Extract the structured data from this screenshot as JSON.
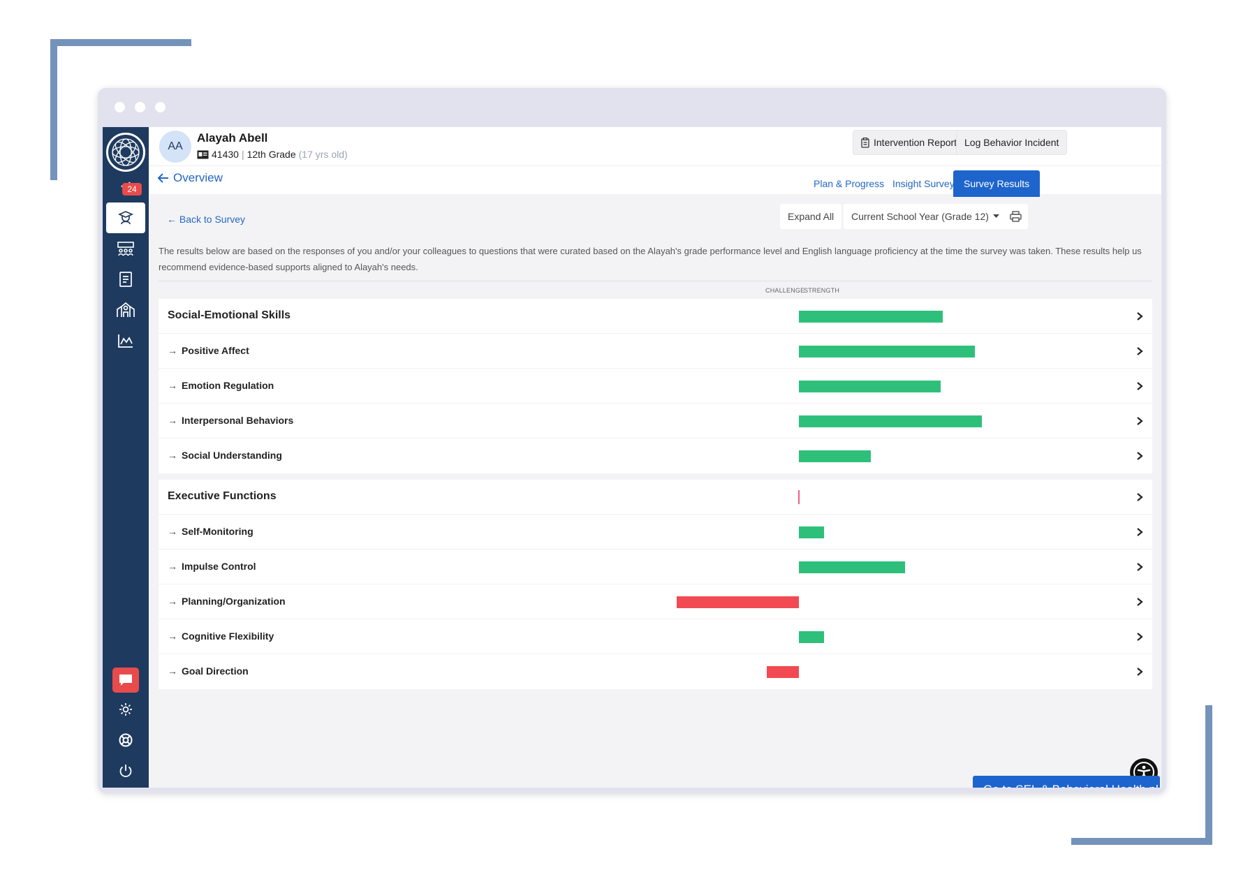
{
  "window": {
    "dots": 3
  },
  "sidebar": {
    "badge_count": "24",
    "items": [
      "notifications-icon",
      "students-icon",
      "groups-icon",
      "document-icon",
      "school-icon",
      "analytics-icon",
      "chat-icon",
      "settings-icon",
      "support-icon",
      "power-icon"
    ]
  },
  "header": {
    "avatar_initials": "AA",
    "student_name": "Alayah Abell",
    "student_id": "41430",
    "separator": "|",
    "grade": "12th Grade",
    "age": "(17 yrs old)",
    "intervention_report_label": "Intervention Report",
    "log_behavior_label": "Log Behavior Incident"
  },
  "subheader": {
    "overview_label": "Overview",
    "tabs": [
      {
        "label": "Plan & Progress",
        "active": false
      },
      {
        "label": "Insight Survey",
        "active": false
      },
      {
        "label": "Survey Results",
        "active": true
      }
    ]
  },
  "controls": {
    "back_label": "← Back to Survey",
    "expand_all_label": "Expand All",
    "year_select_value": "Current School Year (Grade 12)"
  },
  "intro_text": "The results below are based on the responses of you and/or your colleagues to questions that were curated based on the Alayah's grade performance level and English language proficiency at the time the survey was taken. These results help us recommend evidence-based supports aligned to Alayah's needs.",
  "axis": {
    "challenge": "CHALLENGE",
    "strength": "STRENGTH"
  },
  "colors": {
    "strength": "#2ec07a",
    "challenge": "#f24a52",
    "accent": "#1d64cc",
    "sidebar": "#1e3a5f"
  },
  "chart_data": {
    "type": "bar",
    "orientation": "horizontal-diverging",
    "xlim": [
      -1,
      1
    ],
    "groups": [
      {
        "name": "Social-Emotional Skills",
        "value": 0.8,
        "items": [
          {
            "name": "Positive Affect",
            "value": 0.98
          },
          {
            "name": "Emotion Regulation",
            "value": 0.79
          },
          {
            "name": "Interpersonal Behaviors",
            "value": 1.02
          },
          {
            "name": "Social Understanding",
            "value": 0.4
          }
        ]
      },
      {
        "name": "Executive Functions",
        "value": 0,
        "items": [
          {
            "name": "Self-Monitoring",
            "value": 0.14
          },
          {
            "name": "Impulse Control",
            "value": 0.59
          },
          {
            "name": "Planning/Organization",
            "value": -0.68
          },
          {
            "name": "Cognitive Flexibility",
            "value": 0.14
          },
          {
            "name": "Goal Direction",
            "value": -0.18
          }
        ]
      }
    ]
  },
  "cta_label": "Go to SEL & Behavioral Health plan"
}
